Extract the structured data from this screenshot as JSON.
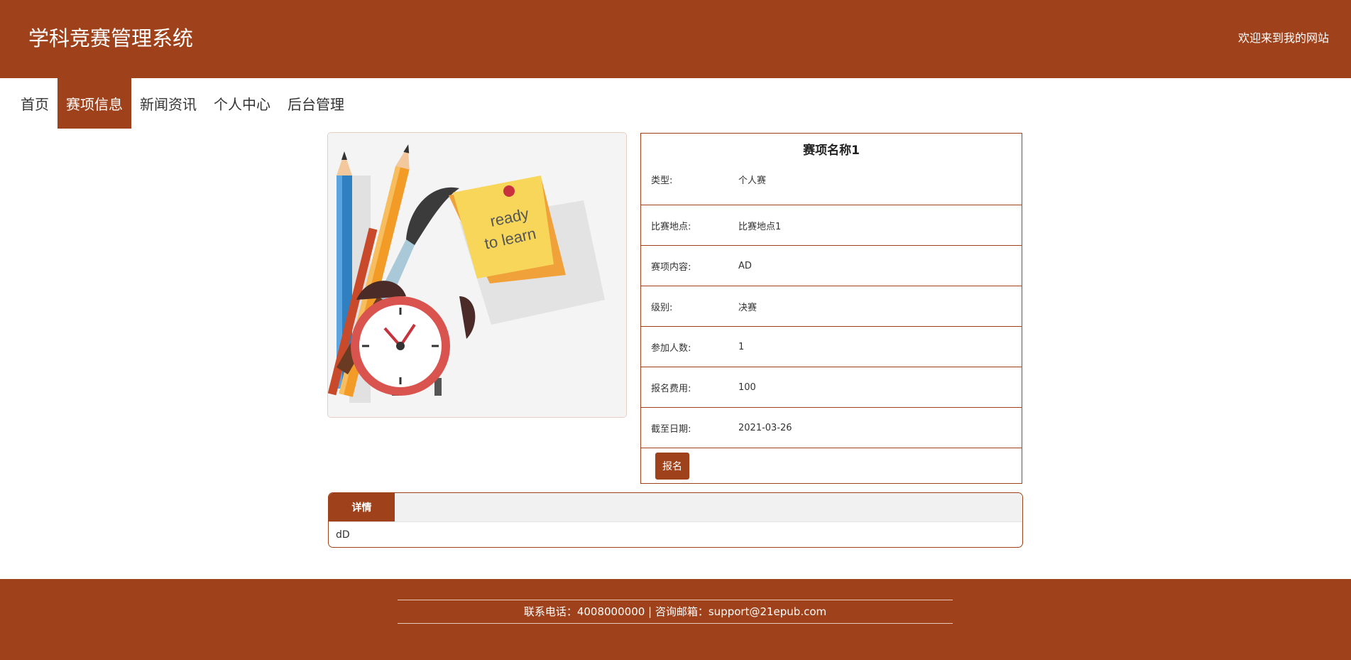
{
  "header": {
    "title": "学科竞赛管理系统",
    "welcome": "欢迎来到我的网站"
  },
  "nav": {
    "items": [
      {
        "label": "首页",
        "active": false
      },
      {
        "label": "赛项信息",
        "active": true
      },
      {
        "label": "新闻资讯",
        "active": false
      },
      {
        "label": "个人中心",
        "active": false
      },
      {
        "label": "后台管理",
        "active": false
      }
    ]
  },
  "image": {
    "note_line1": "ready",
    "note_line2": "to learn"
  },
  "competition": {
    "name": "赛项名称1",
    "fields": [
      {
        "label": "类型:",
        "value": "个人赛"
      },
      {
        "label": "比赛地点:",
        "value": "比赛地点1"
      },
      {
        "label": "赛项内容:",
        "value": "AD"
      },
      {
        "label": "级别:",
        "value": "决赛"
      },
      {
        "label": "参加人数:",
        "value": "1"
      },
      {
        "label": "报名费用:",
        "value": "100"
      },
      {
        "label": "截至日期:",
        "value": "2021-03-26"
      }
    ],
    "signup_label": "报名"
  },
  "details": {
    "tab_label": "详情",
    "content": "dD"
  },
  "footer": {
    "contact": "联系电话：4008000000 | 咨询邮箱：support@21epub.com"
  },
  "colors": {
    "brand": "#9f421b",
    "note_yellow": "#f7d65a",
    "pin_red": "#c8323c"
  }
}
